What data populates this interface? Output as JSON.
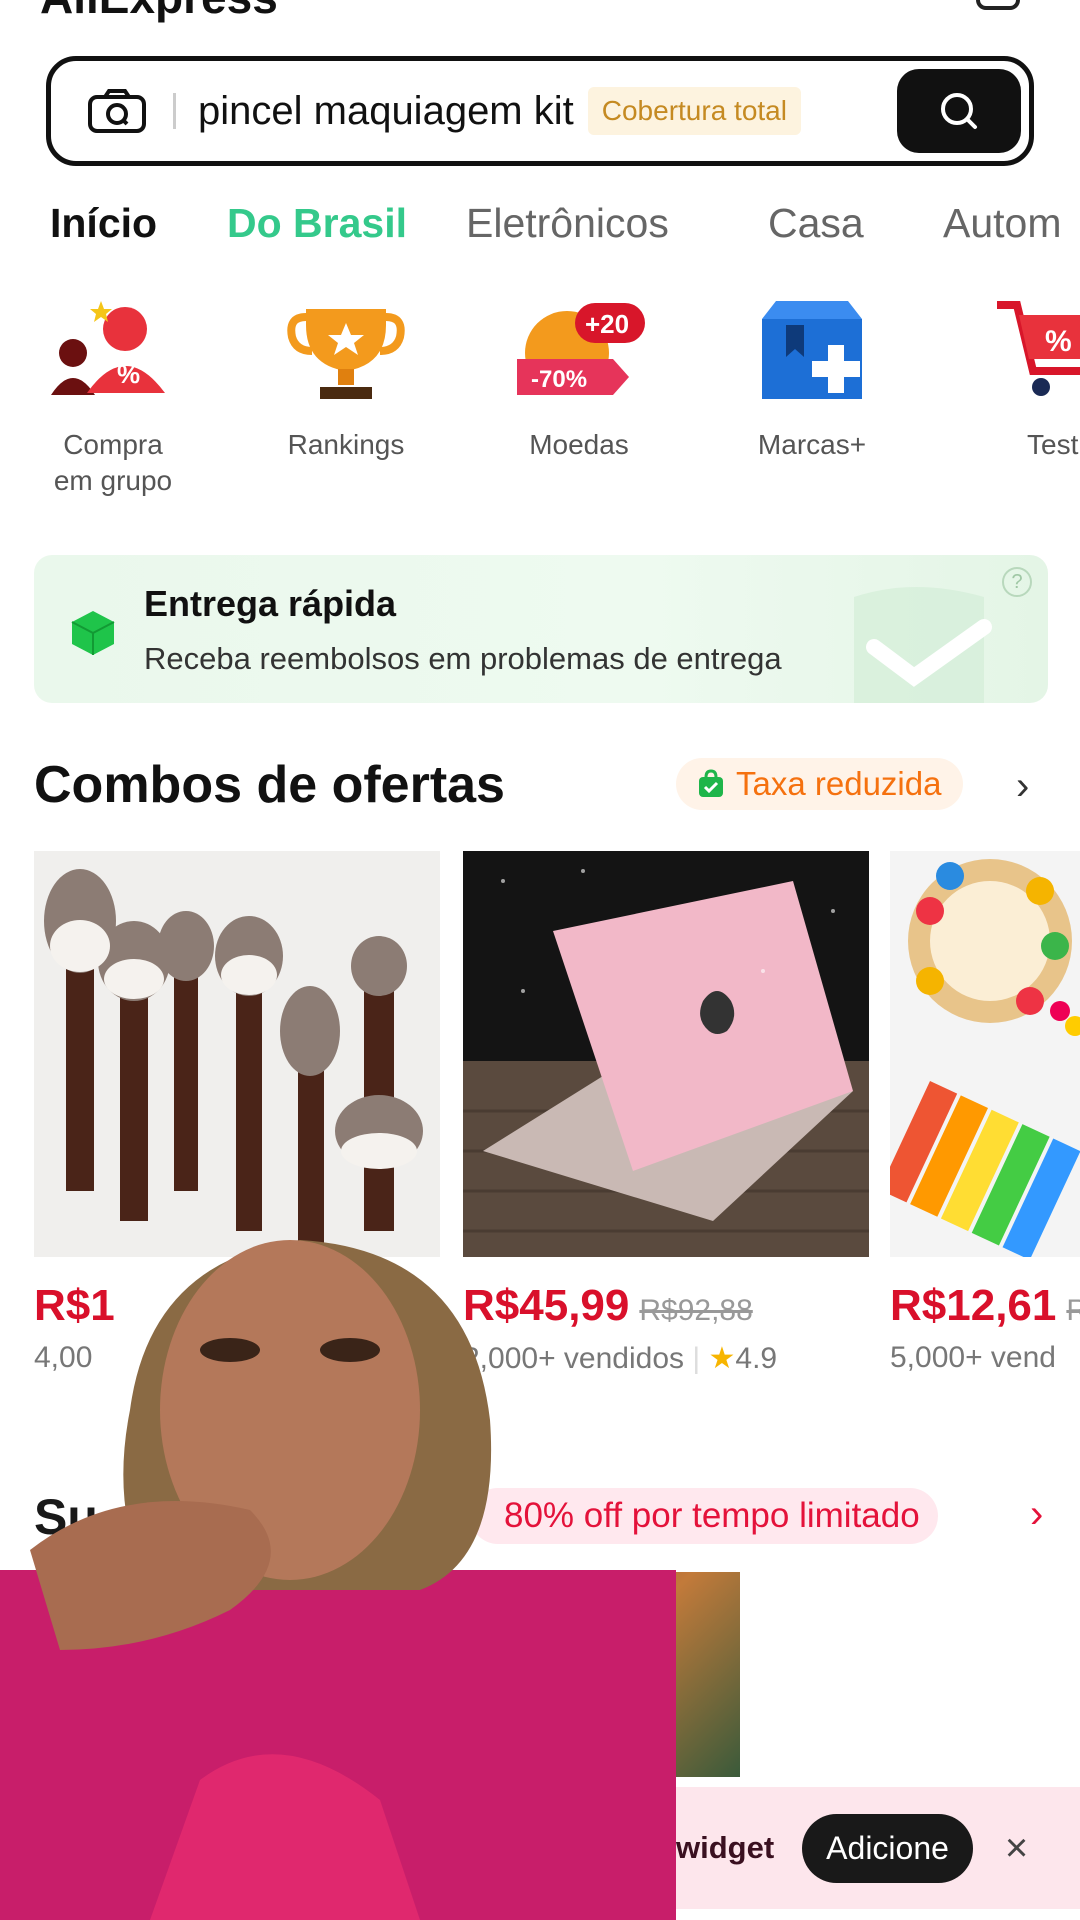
{
  "app": {
    "logo_text": "AliExpress"
  },
  "search": {
    "query": "pincel maquiagem kit",
    "chip": "Cobertura total"
  },
  "tabs": [
    "Início",
    "Do Brasil",
    "Eletrônicos",
    "Casa",
    "Autom"
  ],
  "categories": [
    {
      "label": "Compra\nem grupo",
      "icon": "group-buy-icon"
    },
    {
      "label": "Rankings",
      "icon": "trophy-icon"
    },
    {
      "label": "Moedas",
      "icon": "coins-icon",
      "badge_top": "+20",
      "badge_bottom": "-70%"
    },
    {
      "label": "Marcas+",
      "icon": "brands-box-icon"
    },
    {
      "label": "Test",
      "icon": "cart-icon"
    }
  ],
  "delivery": {
    "title": "Entrega rápida",
    "subtitle": "Receba reembolsos em problemas de entrega"
  },
  "combos": {
    "title": "Combos de ofertas",
    "badge": "Taxa reduzida"
  },
  "products": [
    {
      "price": "R$1",
      "old_price": "",
      "sold": "4,00",
      "rating": ""
    },
    {
      "price": "R$45,99",
      "old_price": "R$92,88",
      "sold": "2,000+ vendidos",
      "rating": "4.9"
    },
    {
      "price": "R$12,61",
      "old_price": "R",
      "sold": "5,000+ vend",
      "rating": ""
    }
  ],
  "super_deals": {
    "title": "Su",
    "pill": "80% off por tempo limitado"
  },
  "widget": {
    "text": "widget",
    "add": "Adicione",
    "close": "×"
  },
  "colors": {
    "accent_red": "#d9102b",
    "brasil_green": "#34c98b",
    "taxa_orange": "#f5710f"
  }
}
